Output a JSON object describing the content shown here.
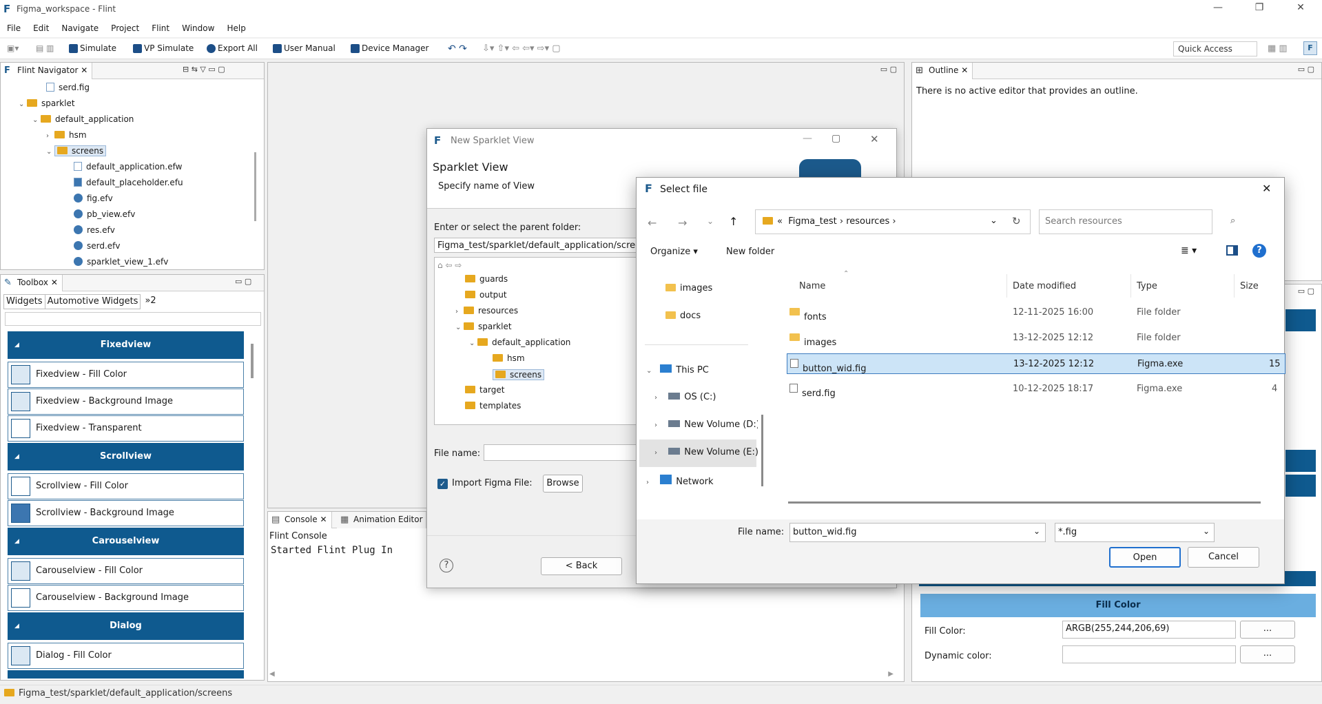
{
  "window": {
    "title": "Figma_workspace - Flint",
    "min": "—",
    "max": "❐",
    "close": "✕"
  },
  "menu": [
    "File",
    "Edit",
    "Navigate",
    "Project",
    "Flint",
    "Window",
    "Help"
  ],
  "toolbar": {
    "simulate": "Simulate",
    "vp_simulate": "VP Simulate",
    "export_all": "Export All",
    "user_manual": "User Manual",
    "device_manager": "Device Manager",
    "quick_access": "Quick Access"
  },
  "navigator": {
    "tab": "Flint Navigator",
    "items": [
      {
        "label": "serd.fig",
        "kind": "file"
      },
      {
        "label": "sparklet",
        "kind": "folder"
      },
      {
        "label": "default_application",
        "kind": "folder"
      },
      {
        "label": "hsm",
        "kind": "folder"
      },
      {
        "label": "screens",
        "kind": "folder"
      },
      {
        "label": "default_application.efw",
        "kind": "file"
      },
      {
        "label": "default_placeholder.efu",
        "kind": "file"
      },
      {
        "label": "fig.efv",
        "kind": "efv"
      },
      {
        "label": "pb_view.efv",
        "kind": "efv"
      },
      {
        "label": "res.efv",
        "kind": "efv"
      },
      {
        "label": "serd.efv",
        "kind": "efv"
      },
      {
        "label": "sparklet_view_1.efv",
        "kind": "efv"
      }
    ]
  },
  "toolbox": {
    "tab": "Toolbox",
    "tabs": [
      "Widgets",
      "Automotive Widgets",
      "»2"
    ],
    "sections": [
      {
        "header": "Fixedview",
        "items": [
          "Fixedview - Fill Color",
          "Fixedview - Background Image",
          "Fixedview - Transparent"
        ]
      },
      {
        "header": "Scrollview",
        "items": [
          "Scrollview - Fill Color",
          "Scrollview - Background Image"
        ]
      },
      {
        "header": "Carouselview",
        "items": [
          "Carouselview - Fill Color",
          "Carouselview - Background Image"
        ]
      },
      {
        "header": "Dialog",
        "items": [
          "Dialog - Fill Color"
        ]
      }
    ]
  },
  "outline": {
    "tab": "Outline",
    "message": "There is no active editor that provides an outline."
  },
  "console": {
    "tab": "Console",
    "tab2": "Animation Editor",
    "title": "Flint Console",
    "text": "Started Flint Plug In"
  },
  "properties": {
    "fill_header": "Fill Color",
    "fill_label": "Fill Color:",
    "fill_value": "ARGB(255,244,206,69)",
    "dynamic_label": "Dynamic color:",
    "dots": "..."
  },
  "sparklet_dialog": {
    "title": "New Sparklet View",
    "heading": "Sparklet View",
    "subheading": "Specify name of View",
    "parent_label": "Enter or select the parent folder:",
    "parent_value": "Figma_test/sparklet/default_application/screens",
    "tree": [
      "guards",
      "output",
      "resources",
      "sparklet",
      "default_application",
      "hsm",
      "screens",
      "target",
      "templates"
    ],
    "file_name_label": "File name:",
    "import_label": "Import Figma File:",
    "browse": "Browse",
    "back": "< Back",
    "help": "?"
  },
  "file_dialog": {
    "title": "Select file",
    "breadcrumb": [
      "«",
      "Figma_test",
      "›",
      "resources",
      "›"
    ],
    "search_placeholder": "Search resources",
    "organize": "Organize ▾",
    "new_folder": "New folder",
    "nav": [
      "images",
      "docs",
      "This PC",
      "OS (C:)",
      "New Volume (D:)",
      "New Volume (E:)",
      "Network"
    ],
    "columns": [
      "Name",
      "Date modified",
      "Type",
      "Size"
    ],
    "files": [
      {
        "name": "fonts",
        "date": "12-11-2025 16:00",
        "type": "File folder",
        "size": "",
        "kind": "folder"
      },
      {
        "name": "images",
        "date": "13-12-2025 12:12",
        "type": "File folder",
        "size": "",
        "kind": "folder"
      },
      {
        "name": "button_wid.fig",
        "date": "13-12-2025 12:12",
        "type": "Figma.exe",
        "size": "15",
        "kind": "file",
        "selected": true
      },
      {
        "name": "serd.fig",
        "date": "10-12-2025 18:17",
        "type": "Figma.exe",
        "size": "4",
        "kind": "file"
      }
    ],
    "file_name_label": "File name:",
    "file_name_value": "button_wid.fig",
    "filter": "*.fig",
    "open": "Open",
    "cancel": "Cancel"
  },
  "status": {
    "path": "Figma_test/sparklet/default_application/screens"
  }
}
